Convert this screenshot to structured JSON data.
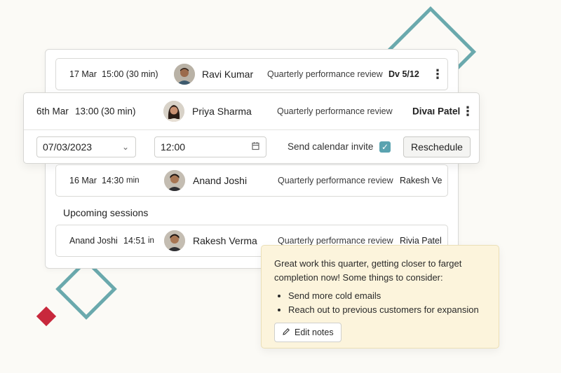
{
  "rows": [
    {
      "date": "17 Mar",
      "time": "15:00 (30 min)",
      "name": "Ravi Kumar",
      "review": "Quarterly performance review",
      "reviewer": "Dv 5/12"
    },
    {
      "date": "6th Mar",
      "time": "13:00",
      "duration": "(30 min)",
      "name": "Priya Sharma",
      "review": "Quarterly performance review",
      "reviewer": "Divaı Patel"
    },
    {
      "date": "16 Mar",
      "time": "14:30",
      "duration": "min",
      "name": "Anand Joshi",
      "review": "Quarterly performance review",
      "reviewer": "Rakesh Ve"
    }
  ],
  "editor": {
    "date_value": "07/03/2023",
    "time_value": "12:00",
    "invite_label": "Send calendar invite",
    "invite_checked": true,
    "reschedule_label": "Reschedule"
  },
  "upcoming": {
    "title": "Upcoming sessions",
    "row": {
      "date": "Anand Joshi",
      "time": "14:51",
      "duration": "in",
      "name": "Rakesh Verma",
      "review": "Quarterly performance review",
      "reviewer": "Rivia Patel"
    }
  },
  "note": {
    "text": "Great work this quarter, getting closer to farget completion now! Some things to consider:",
    "bullets": [
      "Send more cold emails",
      "Reach out to previous customers for expansion"
    ],
    "edit_label": "Edit notes"
  },
  "colors": {
    "accent": "#5aa3b0",
    "deco_teal": "#6aa9ad",
    "deco_red": "#c8283c",
    "note_bg": "#fcf4dc"
  },
  "icons": {
    "kebab": "more-vertical-icon",
    "chevron": "chevron-down-icon",
    "calendar": "calendar-icon",
    "check": "check-icon",
    "pencil": "pencil-icon"
  }
}
